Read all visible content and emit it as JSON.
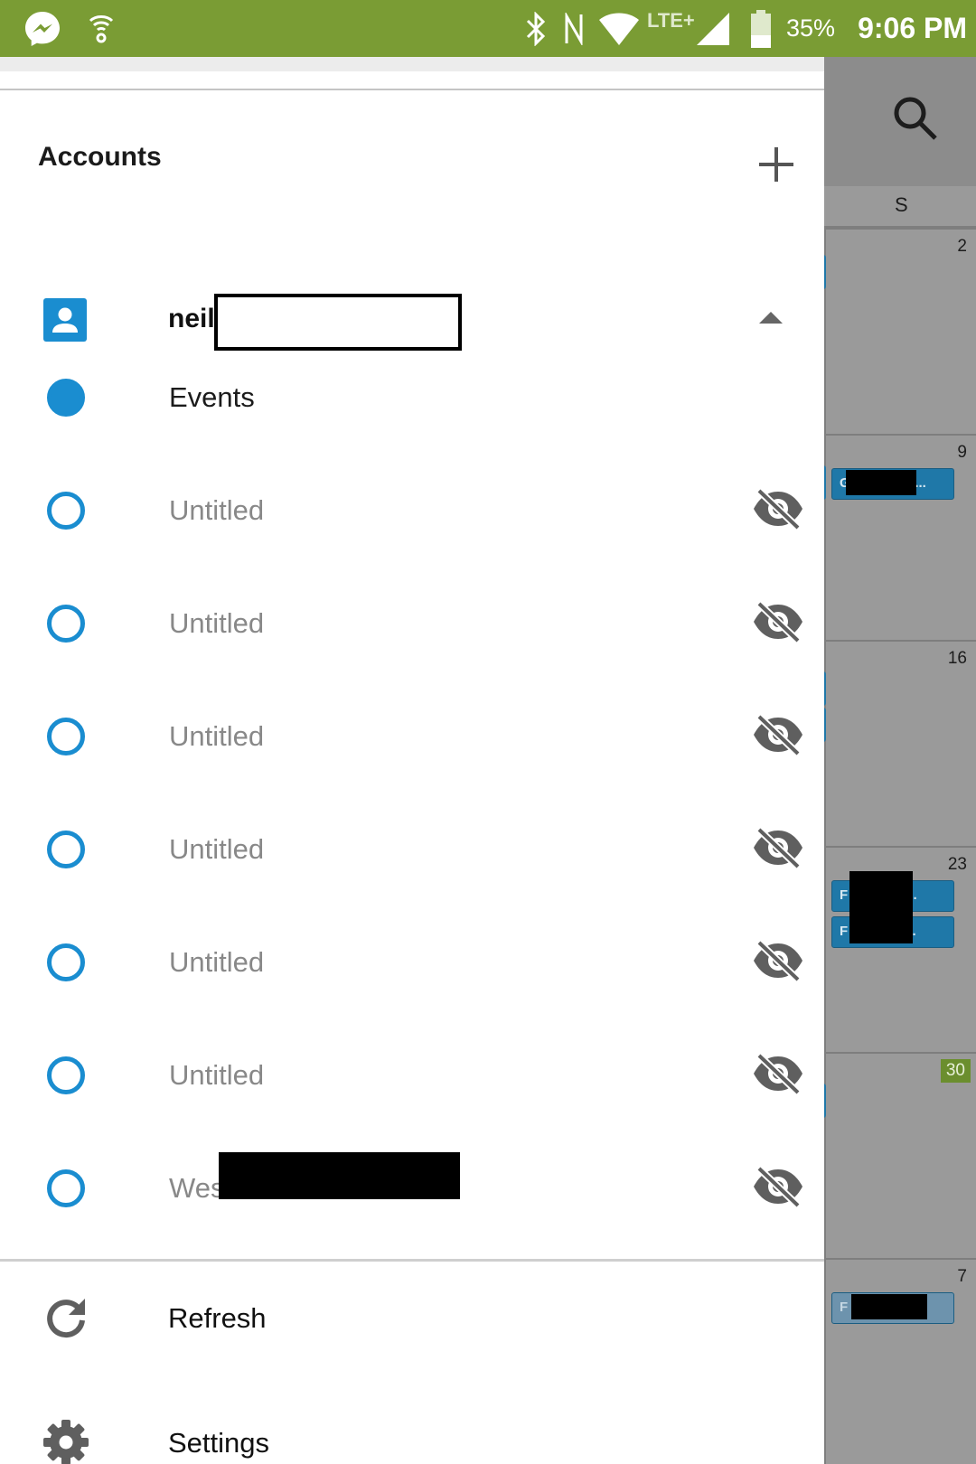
{
  "status_bar": {
    "battery": "35%",
    "time": "9:06 PM",
    "network": "LTE+",
    "icons": [
      "messenger-icon",
      "wifi-hotspot-icon",
      "bluetooth-icon",
      "nfc-icon",
      "wifi-icon",
      "cell-signal-icon",
      "battery-icon"
    ],
    "background": "#7a9c34"
  },
  "calendar": {
    "weekday_label": "S",
    "day_numbers": [
      "2",
      "9",
      "16",
      "23",
      "30",
      "7"
    ],
    "today": "30",
    "events": [
      {
        "week": 1,
        "text": "G              ni..."
      },
      {
        "week": 3,
        "text": "F           Wi..."
      },
      {
        "week": 3,
        "text": "F           To..."
      },
      {
        "week": 5,
        "text": "F              T..."
      }
    ],
    "event_color": "#1f78a8",
    "today_color": "#6b8e2e"
  },
  "drawer": {
    "accounts_title": "Accounts",
    "account": {
      "name": "neil",
      "icon": "account-box-icon",
      "expand_icon": "arrow-drop-up-icon"
    },
    "calendars": [
      {
        "label": "Events",
        "selected": true,
        "hidden": false
      },
      {
        "label": "Untitled",
        "selected": false,
        "hidden": true
      },
      {
        "label": "Untitled",
        "selected": false,
        "hidden": true
      },
      {
        "label": "Untitled",
        "selected": false,
        "hidden": true
      },
      {
        "label": "Untitled",
        "selected": false,
        "hidden": true
      },
      {
        "label": "Untitled",
        "selected": false,
        "hidden": true
      },
      {
        "label": "Untitled",
        "selected": false,
        "hidden": true
      },
      {
        "label": "Wes",
        "selected": false,
        "hidden": true
      }
    ],
    "menu": [
      {
        "label": "Refresh",
        "icon": "refresh-icon"
      },
      {
        "label": "Settings",
        "icon": "gear-icon"
      }
    ],
    "accent": "#1a8dd0"
  }
}
